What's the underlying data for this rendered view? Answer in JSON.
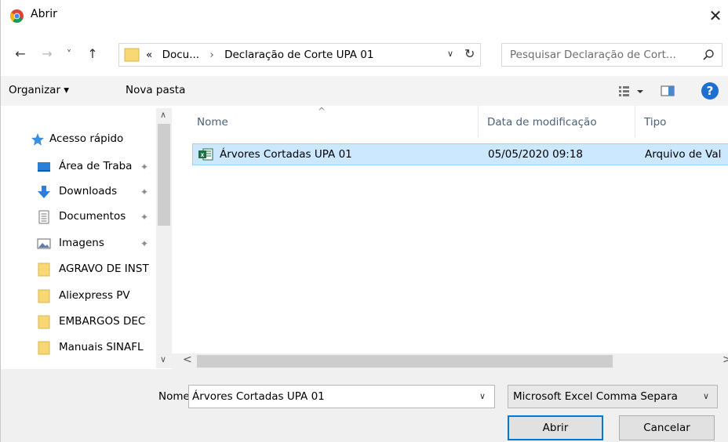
{
  "window": {
    "title": "Abrir",
    "close_glyph": "✕"
  },
  "nav": {
    "back_glyph": "←",
    "forward_glyph": "→",
    "recent_glyph": "˅",
    "up_glyph": "↑"
  },
  "address": {
    "overflow": "«",
    "crumbs": [
      "Docu...",
      "Declaração de Corte UPA 01"
    ],
    "separator": "›",
    "dropdown_glyph": "∨",
    "refresh_glyph": "↻"
  },
  "search": {
    "placeholder": "Pesquisar Declaração de Cort..."
  },
  "toolbar": {
    "organize_label": "Organizar ▾",
    "new_folder_label": "Nova pasta",
    "help_label": "?"
  },
  "sidebar": {
    "items": [
      {
        "label": "Acesso rápido",
        "icon": "star-icon",
        "pinned": false
      },
      {
        "label": "Área de Traba",
        "icon": "desktop-icon",
        "pinned": true
      },
      {
        "label": "Downloads",
        "icon": "download-icon",
        "pinned": true
      },
      {
        "label": "Documentos",
        "icon": "document-icon",
        "pinned": true
      },
      {
        "label": "Imagens",
        "icon": "image-icon",
        "pinned": true
      },
      {
        "label": "AGRAVO DE INST",
        "icon": "folder-icon",
        "pinned": false
      },
      {
        "label": "Aliexpress PV",
        "icon": "folder-icon",
        "pinned": false
      },
      {
        "label": "EMBARGOS DEC",
        "icon": "folder-icon",
        "pinned": false
      },
      {
        "label": "Manuais SINAFL",
        "icon": "folder-icon",
        "pinned": false
      }
    ],
    "pin_glyph": "✦"
  },
  "file_list": {
    "columns": [
      "Nome",
      "Data de modificação",
      "Tipo"
    ],
    "sort_glyph": "^",
    "rows": [
      {
        "name": "Árvores Cortadas UPA 01",
        "modified": "05/05/2020 09:18",
        "type": "Arquivo de Val",
        "icon": "excel-file-icon",
        "selected": true
      }
    ]
  },
  "scrollbars": {
    "up_glyph": "∧",
    "down_glyph": "∨",
    "left_glyph": "<",
    "right_glyph": ">"
  },
  "footer": {
    "name_label": "Nome:",
    "file_name_value": "Árvores Cortadas UPA 01",
    "dropdown_glyph": "∨",
    "file_type_value": "Microsoft Excel Comma Separa",
    "open_button": "Abrir",
    "cancel_button": "Cancelar"
  },
  "colors": {
    "accent": "#0078d7",
    "selection": "#cce8ff",
    "folder": "#f8d775",
    "excel": "#1d7044",
    "help": "#1f6fd0"
  }
}
